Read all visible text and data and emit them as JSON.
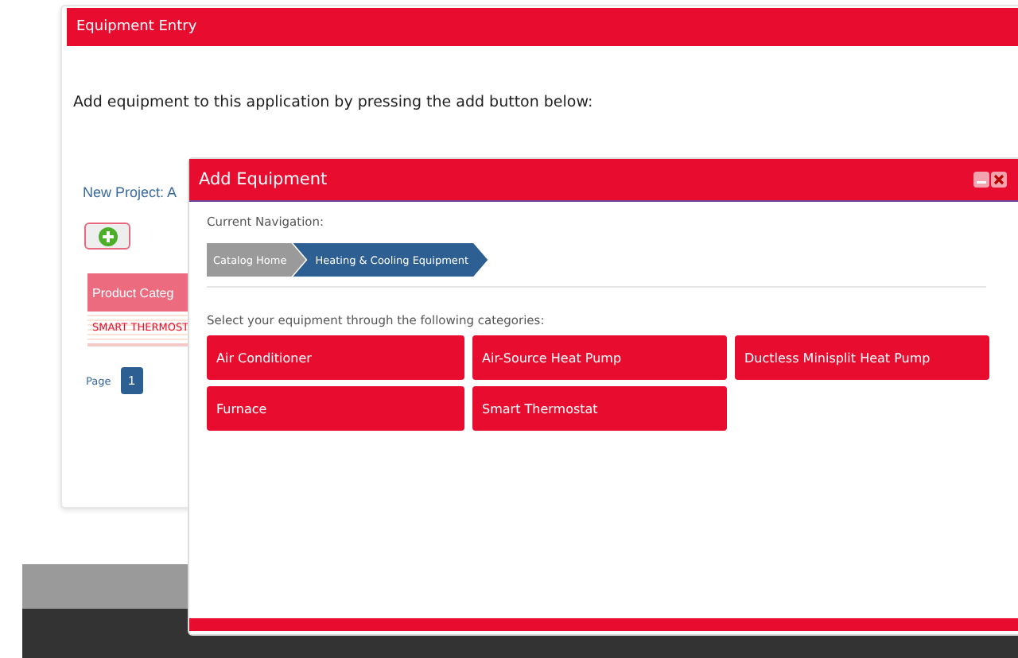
{
  "panel": {
    "title": "Equipment Entry",
    "instructions": "Add equipment to this application by pressing the add button below:",
    "project_link": "New Project: A",
    "table": {
      "columns": [
        "Product Categ"
      ],
      "rows": [
        [
          "SMART THERMOST"
        ]
      ]
    },
    "pager": {
      "label": "Page",
      "pages": [
        {
          "label": "1",
          "selected": true
        }
      ]
    }
  },
  "dialog": {
    "title": "Add Equipment",
    "navigation_label": "Current Navigation:",
    "breadcrumbs": [
      {
        "label": "Catalog Home",
        "selected": false
      },
      {
        "label": "Heating & Cooling Equipment",
        "selected": true
      }
    ],
    "prompt": "Select your equipment through the following categories:",
    "categories": [
      "Air Conditioner",
      "Air-Source Heat Pump",
      "Ductless Minisplit Heat Pump",
      "Furnace",
      "Smart Thermostat"
    ]
  }
}
